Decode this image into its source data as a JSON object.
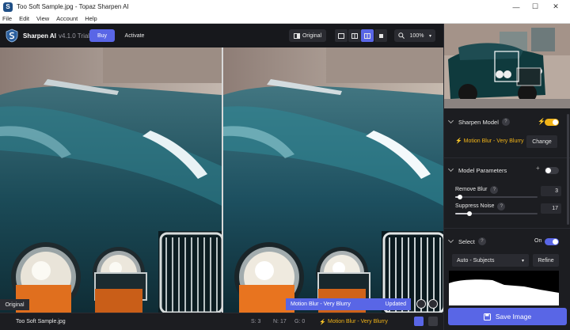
{
  "window": {
    "title": "Too Soft Sample.jpg - Topaz Sharpen AI",
    "controls": {
      "minimize": "—",
      "maximize": "☐",
      "close": "✕"
    }
  },
  "menu": [
    "File",
    "Edit",
    "View",
    "Account",
    "Help"
  ],
  "toolbar": {
    "brand": "Sharpen AI",
    "version": "v4.1.0 Trial",
    "help": "?",
    "buy_label": "Buy",
    "activate_label": "Activate",
    "original_label": "Original",
    "zoom_label": "100%",
    "active_view_index": 2
  },
  "viewport": {
    "original_badge": "Original",
    "status_model": "Motion Blur - Very Blurry",
    "status_state": "Updated"
  },
  "statusbar": {
    "filename": "Too Soft Sample.jpg",
    "s_value": "S: 3",
    "n_value": "N: 17",
    "g_value": "G: 0",
    "model": "Motion Blur - Very Blurry"
  },
  "panel": {
    "sharpen_model": {
      "heading": "Sharpen Model",
      "help": "?",
      "enabled": true,
      "model_name": "Motion Blur - Very Blurry",
      "change_label": "Change"
    },
    "model_parameters": {
      "heading": "Model Parameters",
      "enabled": false,
      "remove_blur": {
        "label": "Remove Blur",
        "help": "?",
        "value": "3",
        "fraction": 0.06
      },
      "suppress_noise": {
        "label": "Suppress Noise",
        "help": "?",
        "value": "17",
        "fraction": 0.17
      }
    },
    "select": {
      "heading": "Select",
      "help": "?",
      "state_label": "On",
      "enabled": true,
      "mode": "Auto - Subjects",
      "refine_label": "Refine"
    },
    "save_label": "Save Image"
  },
  "colors": {
    "accent": "#5966e6",
    "model_yellow": "#f2b418",
    "panel_bg": "#1c1d21"
  }
}
